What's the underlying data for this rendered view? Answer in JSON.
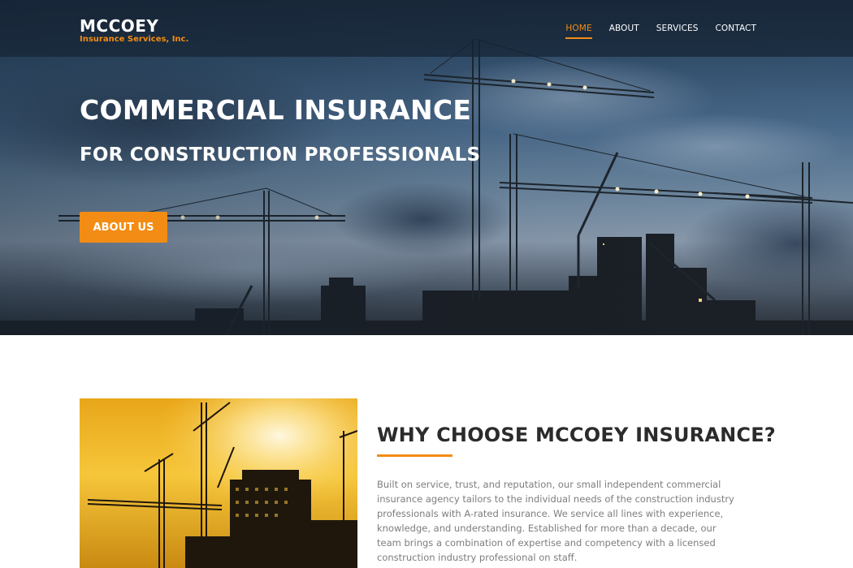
{
  "header": {
    "logo_main": "MCCOEY",
    "logo_sub": "Insurance Services, Inc.",
    "nav": [
      {
        "label": "HOME",
        "active": true
      },
      {
        "label": "ABOUT",
        "active": false
      },
      {
        "label": "SERVICES",
        "active": false
      },
      {
        "label": "CONTACT",
        "active": false
      }
    ]
  },
  "hero": {
    "title": "COMMERCIAL INSURANCE",
    "subtitle": "FOR CONSTRUCTION PROFESSIONALS",
    "button_label": "ABOUT US",
    "image": "construction-cranes-dusk-photo"
  },
  "section": {
    "image": "construction-cranes-sunset-photo",
    "title": "WHY CHOOSE MCCOEY INSURANCE?",
    "body": "Built on service, trust, and reputation, our small independent commercial insurance agency tailors to the individual needs of the construction industry professionals with A-rated insurance. We service all lines with experience, knowledge, and understanding. Established for more than a decade, our team brings a combination of expertise and competency with a licensed construction industry professional on staff."
  },
  "colors": {
    "accent": "#f28c14",
    "heading": "#2b2b2b",
    "body_text": "#7d7d7d",
    "header_bg": "#162434"
  }
}
